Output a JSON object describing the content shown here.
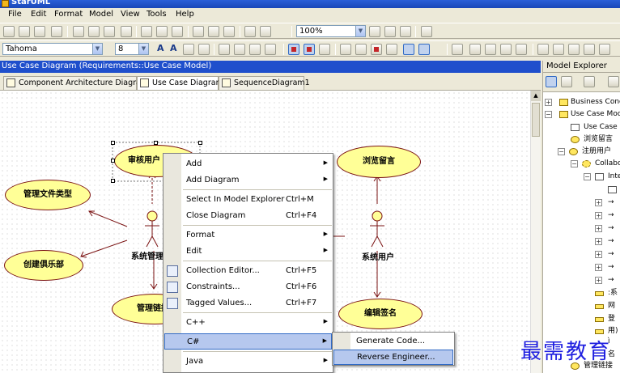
{
  "window": {
    "title": "StarUML"
  },
  "menu": {
    "items": [
      "File",
      "Edit",
      "Format",
      "Model",
      "View",
      "Tools",
      "Help"
    ]
  },
  "toolbar": {
    "zoom": "100%",
    "font": "Tahoma",
    "font_size": "8"
  },
  "diagram": {
    "header": "Use Case Diagram (Requirements::Use Case Model)",
    "tabs": [
      {
        "label": "Component Architecture Diagram",
        "active": false
      },
      {
        "label": "Use Case Diagram",
        "active": true
      },
      {
        "label": "SequenceDiagram1",
        "active": false
      }
    ],
    "usecases": [
      "审核用户",
      "浏览留言",
      "管理文件类型",
      "创建俱乐部",
      "管理链接",
      "编辑签名"
    ],
    "actors": [
      "系统管理员",
      "系统用户"
    ]
  },
  "explorer": {
    "title": "Model Explorer",
    "tree": [
      "Business Conce",
      "Use Case Mod",
      "Use Case D",
      "浏览留言",
      "注册用户",
      "Collabo",
      "Inte",
      "",
      "→",
      "→",
      "→",
      "→",
      "→",
      "→",
      "→",
      ":系",
      "网",
      "登",
      "用)",
      "ì",
      "名",
      "管理链接"
    ]
  },
  "context_menu": {
    "items": [
      {
        "label": "Add",
        "shortcut": "",
        "submenu": true
      },
      {
        "label": "Add Diagram",
        "shortcut": "",
        "submenu": true
      },
      {
        "label": "Select In Model Explorer",
        "shortcut": "Ctrl+M",
        "submenu": false
      },
      {
        "label": "Close Diagram",
        "shortcut": "Ctrl+F4",
        "submenu": false
      },
      {
        "label": "Format",
        "shortcut": "",
        "submenu": true
      },
      {
        "label": "Edit",
        "shortcut": "",
        "submenu": true
      },
      {
        "label": "Collection Editor...",
        "shortcut": "Ctrl+F5",
        "submenu": false
      },
      {
        "label": "Constraints...",
        "shortcut": "Ctrl+F6",
        "submenu": false
      },
      {
        "label": "Tagged Values...",
        "shortcut": "Ctrl+F7",
        "submenu": false
      },
      {
        "label": "C++",
        "shortcut": "",
        "submenu": true
      },
      {
        "label": "C#",
        "shortcut": "",
        "submenu": true
      },
      {
        "label": "Java",
        "shortcut": "",
        "submenu": true
      }
    ]
  },
  "submenu": {
    "items": [
      "Generate Code...",
      "Reverse Engineer..."
    ]
  },
  "watermark": {
    "text": "最需教育"
  }
}
